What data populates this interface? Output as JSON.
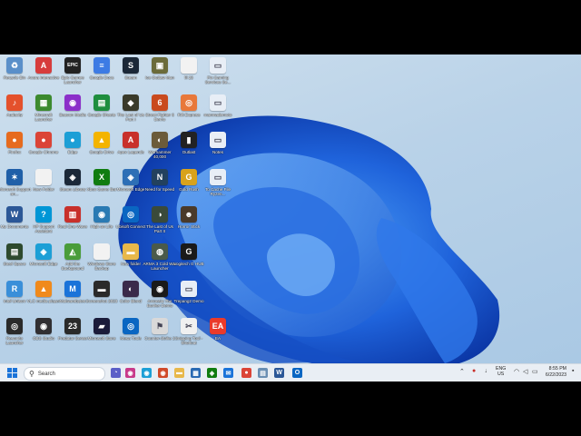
{
  "desktop": {
    "icons": [
      {
        "label": "Recycle Bin",
        "glyph": "♻",
        "color": "#5a8fc9",
        "col": 0,
        "row": 0
      },
      {
        "label": "Acura Interactive",
        "glyph": "A",
        "color": "#d73c3c",
        "col": 1,
        "row": 0
      },
      {
        "label": "Epic Games Launcher",
        "glyph": "EPIC",
        "color": "#222222",
        "col": 2,
        "row": 0
      },
      {
        "label": "Google Docs",
        "glyph": "≡",
        "color": "#3d7be4",
        "col": 3,
        "row": 0
      },
      {
        "label": "Steam",
        "glyph": "S",
        "color": "#1b2838",
        "col": 4,
        "row": 0
      },
      {
        "label": "Ice Outlaw Man",
        "glyph": "▣",
        "color": "#6b6b3a",
        "col": 5,
        "row": 0
      },
      {
        "label": "fil 23",
        "glyph": "",
        "color": "#f2f2f2",
        "col": 6,
        "row": 0
      },
      {
        "label": "Fix Gaming Services Se...",
        "glyph": "▭",
        "color": "#e8eef6",
        "col": 7,
        "row": 0
      },
      {
        "label": "Audacity",
        "glyph": "♪",
        "color": "#e4512c",
        "col": 0,
        "row": 1
      },
      {
        "label": "Minecraft Launcher",
        "glyph": "▦",
        "color": "#3c8a2e",
        "col": 1,
        "row": 1
      },
      {
        "label": "Beacon Media",
        "glyph": "◉",
        "color": "#8b2fc9",
        "col": 2,
        "row": 1
      },
      {
        "label": "Google Sheets",
        "glyph": "▤",
        "color": "#1e8e3e",
        "col": 3,
        "row": 1
      },
      {
        "label": "The Last of Us Part I",
        "glyph": "◆",
        "color": "#3a3a2a",
        "col": 4,
        "row": 1
      },
      {
        "label": "Street Fighter 6 Demo",
        "glyph": "6",
        "color": "#c94a1e",
        "col": 5,
        "row": 1
      },
      {
        "label": "Rift Express",
        "glyph": "◎",
        "color": "#e8783a",
        "col": 6,
        "row": 1
      },
      {
        "label": "manmademoto",
        "glyph": "▭",
        "color": "#e8eef6",
        "col": 7,
        "row": 1
      },
      {
        "label": "Firefox",
        "glyph": "●",
        "color": "#e66b1f",
        "col": 0,
        "row": 2
      },
      {
        "label": "Google Chrome",
        "glyph": "●",
        "color": "#db4437",
        "col": 1,
        "row": 2
      },
      {
        "label": "Edge",
        "glyph": "●",
        "color": "#1c9fd6",
        "col": 2,
        "row": 2
      },
      {
        "label": "Google Drive",
        "glyph": "▲",
        "color": "#f4b400",
        "col": 3,
        "row": 2
      },
      {
        "label": "Apex Legends",
        "glyph": "A",
        "color": "#c8302b",
        "col": 4,
        "row": 2
      },
      {
        "label": "Warhammer 40,000",
        "glyph": "◐",
        "color": "#6b5b3a",
        "col": 5,
        "row": 2
      },
      {
        "label": "Outlast",
        "glyph": "▮",
        "color": "#222222",
        "col": 6,
        "row": 2
      },
      {
        "label": "Notes",
        "glyph": "▭",
        "color": "#e8eef6",
        "col": 7,
        "row": 2
      },
      {
        "label": "Microsoft Support an...",
        "glyph": "✶",
        "color": "#1f5fa8",
        "col": 0,
        "row": 3
      },
      {
        "label": "New Folder",
        "glyph": "",
        "color": "#f2f2f2",
        "col": 1,
        "row": 3
      },
      {
        "label": "Steam Library",
        "glyph": "◈",
        "color": "#1b2838",
        "col": 2,
        "row": 3
      },
      {
        "label": "Xbox Game Bar",
        "glyph": "X",
        "color": "#107c10",
        "col": 3,
        "row": 3
      },
      {
        "label": "Microsoft Edge",
        "glyph": "◈",
        "color": "#2d6fb6",
        "col": 4,
        "row": 3
      },
      {
        "label": "Need for Speed",
        "glyph": "N",
        "color": "#23415e",
        "col": 5,
        "row": 3
      },
      {
        "label": "Gold Rush",
        "glyph": "G",
        "color": "#d8a21c",
        "col": 6,
        "row": 3
      },
      {
        "label": "To Cache File Ryzen...",
        "glyph": "▭",
        "color": "#e8eef6",
        "col": 7,
        "row": 3
      },
      {
        "label": "My Documents",
        "glyph": "W",
        "color": "#2b5797",
        "col": 0,
        "row": 4
      },
      {
        "label": "HP Support Assistant",
        "glyph": "?",
        "color": "#0096d6",
        "col": 1,
        "row": 4
      },
      {
        "label": "Real One Wave",
        "glyph": "▥",
        "color": "#c8302b",
        "col": 2,
        "row": 4
      },
      {
        "label": "High on Life",
        "glyph": "◉",
        "color": "#2a7ab3",
        "col": 3,
        "row": 4
      },
      {
        "label": "Ubisoft Connect",
        "glyph": "◎",
        "color": "#0a66c2",
        "col": 4,
        "row": 4
      },
      {
        "label": "The Last of Us Part II",
        "glyph": "◑",
        "color": "#3a4a3a",
        "col": 5,
        "row": 4
      },
      {
        "label": "Horror Stick",
        "glyph": "☻",
        "color": "#4a3a2a",
        "col": 6,
        "row": 4
      },
      {
        "label": "Steel Space",
        "glyph": "▤",
        "color": "#2e4a2e",
        "col": 0,
        "row": 5
      },
      {
        "label": "Microsoft Edge",
        "glyph": "◈",
        "color": "#1c9fd6",
        "col": 1,
        "row": 5
      },
      {
        "label": "Add the Background",
        "glyph": "◭",
        "color": "#4a9d3a",
        "col": 2,
        "row": 5
      },
      {
        "label": "Windows Store Backup",
        "glyph": "",
        "color": "#f2f2f2",
        "col": 3,
        "row": 5
      },
      {
        "label": "New folder",
        "glyph": "▬",
        "color": "#e8b84a",
        "col": 4,
        "row": 5
      },
      {
        "label": "ARMA 3 Cold War Launcher",
        "glyph": "◍",
        "color": "#4a5a4a",
        "col": 5,
        "row": 5
      },
      {
        "label": "Logitech G HUB",
        "glyph": "G",
        "color": "#1a1a1a",
        "col": 6,
        "row": 5
      },
      {
        "label": "Intel Unison",
        "glyph": "R",
        "color": "#3a8fd9",
        "col": 0,
        "row": 6
      },
      {
        "label": "VLC media player",
        "glyph": "▲",
        "color": "#f08a1c",
        "col": 1,
        "row": 6
      },
      {
        "label": "Malwarebytes",
        "glyph": "M",
        "color": "#1a73d9",
        "col": 2,
        "row": 6
      },
      {
        "label": "Screenshot 2023",
        "glyph": "▬",
        "color": "#2a2a2a",
        "col": 3,
        "row": 6
      },
      {
        "label": "Color Blend",
        "glyph": "◐",
        "color": "#3a2a4a",
        "col": 4,
        "row": 6
      },
      {
        "label": "Amnesia The Bunker Demo",
        "glyph": "◉",
        "color": "#1a1a1a",
        "col": 5,
        "row": 6
      },
      {
        "label": "Trepang2 Demo",
        "glyph": "▭",
        "color": "#e8eef6",
        "col": 6,
        "row": 6
      },
      {
        "label": "Resonite Launcher",
        "glyph": "◎",
        "color": "#2a2a2a",
        "col": 0,
        "row": 7
      },
      {
        "label": "OBS Studio",
        "glyph": "◉",
        "color": "#302e31",
        "col": 1,
        "row": 7
      },
      {
        "label": "Predator Sense",
        "glyph": "23",
        "color": "#2a2a2a",
        "col": 2,
        "row": 7
      },
      {
        "label": "Microsoft Store",
        "glyph": "▰",
        "color": "#1b1b3a",
        "col": 3,
        "row": 7
      },
      {
        "label": "Mesa Tools",
        "glyph": "◎",
        "color": "#0a66c2",
        "col": 4,
        "row": 7
      },
      {
        "label": "Counter-Strike 2",
        "glyph": "⚑",
        "color": "#d9d9d9",
        "col": 5,
        "row": 7
      },
      {
        "label": "Snipping Tool - Shortcut",
        "glyph": "✂",
        "color": "#f0f0f0",
        "col": 6,
        "row": 7
      },
      {
        "label": "EA",
        "glyph": "EA",
        "color": "#ea3a2a",
        "col": 7,
        "row": 7
      }
    ]
  },
  "taskbar": {
    "search_placeholder": "Search",
    "apps": [
      {
        "name": "chat",
        "glyph": "◔",
        "color": "#5b5fc7"
      },
      {
        "name": "widgets",
        "glyph": "◉",
        "color": "#c83a8a"
      },
      {
        "name": "edge",
        "glyph": "◉",
        "color": "#1c9fd6"
      },
      {
        "name": "meet",
        "glyph": "◉",
        "color": "#d04a2a"
      },
      {
        "name": "file-explorer",
        "glyph": "▬",
        "color": "#e8b84a"
      },
      {
        "name": "store",
        "glyph": "▦",
        "color": "#2a6ab3"
      },
      {
        "name": "xbox",
        "glyph": "◈",
        "color": "#107c10"
      },
      {
        "name": "mail",
        "glyph": "✉",
        "color": "#1a73d9"
      },
      {
        "name": "chrome",
        "glyph": "●",
        "color": "#db4437"
      },
      {
        "name": "notepad",
        "glyph": "▤",
        "color": "#6a8fb3"
      },
      {
        "name": "word",
        "glyph": "W",
        "color": "#2b5797"
      },
      {
        "name": "outlook",
        "glyph": "O",
        "color": "#0a66c2"
      }
    ],
    "tray": {
      "lang_line1": "ENG",
      "lang_line2": "US",
      "time": "8:55 PM",
      "date": "6/22/2023"
    }
  },
  "colors": {
    "accent": "#1a73d9",
    "bloom_dark": "#0b3fb0",
    "bloom_light": "#3f8ff0"
  }
}
